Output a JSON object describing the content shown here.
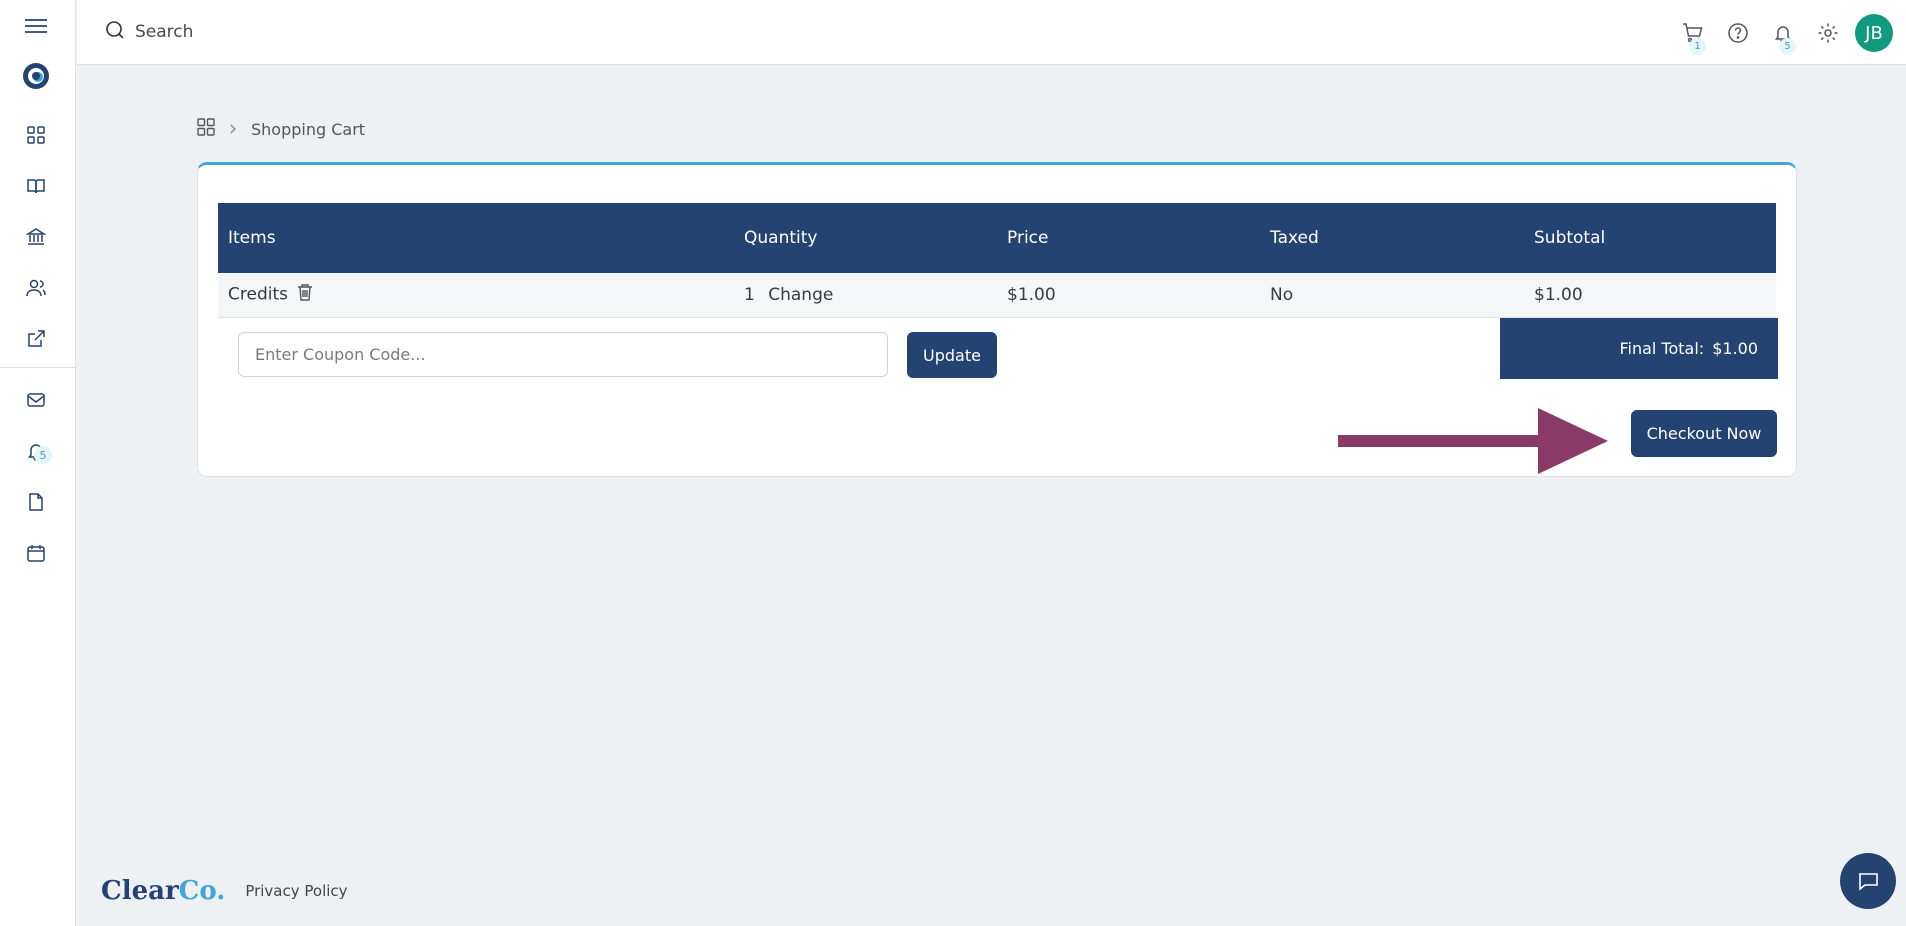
{
  "topbar": {
    "search_placeholder": "Search",
    "cart_count": "1",
    "notifications_count": "5",
    "avatar_initials": "JB"
  },
  "sidebar": {
    "notifications_count": "5",
    "items": [
      "menu-icon",
      "brand-logo",
      "dashboard-icon",
      "book-icon",
      "bank-icon",
      "users-icon",
      "external-link-icon",
      "mail-icon",
      "bell-icon",
      "file-icon",
      "calendar-icon"
    ]
  },
  "breadcrumb": {
    "current": "Shopping Cart"
  },
  "cart": {
    "headers": [
      "Items",
      "Quantity",
      "Price",
      "Taxed",
      "Subtotal"
    ],
    "rows": [
      {
        "item": "Credits",
        "quantity": "1",
        "change_label": "Change",
        "price": "$1.00",
        "taxed": "No",
        "subtotal": "$1.00"
      }
    ],
    "coupon_placeholder": "Enter Coupon Code...",
    "update_label": "Update",
    "final_total_label": "Final Total:",
    "final_total_value": "$1.00",
    "checkout_label": "Checkout Now"
  },
  "footer": {
    "logo_main": "Clear",
    "logo_accent": "Co.",
    "privacy_label": "Privacy Policy"
  },
  "colors": {
    "primary": "#244372",
    "accent": "#41a5d9",
    "avatar": "#129a7e",
    "arrow": "#8a3a66"
  }
}
